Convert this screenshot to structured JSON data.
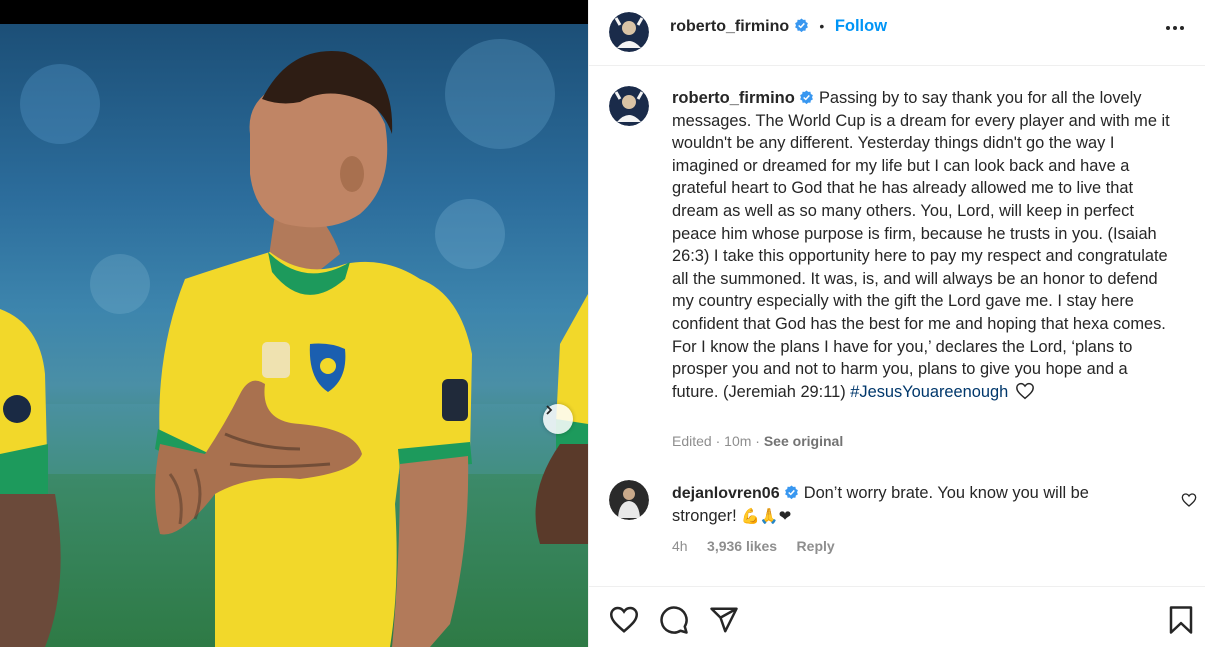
{
  "post": {
    "username": "roberto_firmino",
    "follow_label": "Follow",
    "separator": "•"
  },
  "caption": {
    "username": "roberto_firmino",
    "text": "Passing by to say thank you for all the lovely messages. The World Cup is a dream for every player and with me it wouldn't be any different. Yesterday things didn't go the way I imagined or dreamed for my life but I can look back and have a grateful heart to God that he has already allowed me to live that dream as well as so many others. You, Lord, will keep in perfect peace him whose purpose is firm, because he trusts in you. (Isaiah 26:3) I take this opportunity here to pay my respect and congratulate all the summoned. It was, is, and will always be an honor to defend my country especially with the gift the Lord gave me. I stay here confident that God has the best for me and hoping that hexa comes. For I know the plans I have for you,’ declares the Lord, ‘plans to prosper you and not to harm you, plans to give you hope and a future. (Jeremiah 29:11)",
    "hashtag": "#JesusYouareenough",
    "edited_label": "Edited",
    "time": "10m",
    "meta_sep": "·",
    "see_original": "See original"
  },
  "comment": {
    "username": "dejanlovren06",
    "text": "Don’t worry brate. You know you will be stronger!",
    "emojis": "💪🙏❤",
    "time": "4h",
    "likes": "3,936 likes",
    "reply_label": "Reply"
  },
  "icons": {
    "like": "heart-icon",
    "comment": "comment-icon",
    "share": "share-icon",
    "save": "bookmark-icon",
    "more": "more-options-icon",
    "next": "chevron-right-icon",
    "verified": "verified-badge-icon"
  },
  "colors": {
    "accent": "#0095f6",
    "verified": "#3897f0",
    "hashtag": "#00376b",
    "muted": "#8e8e8e",
    "jersey_yellow": "#f2d82a",
    "jersey_green": "#1d9a5c"
  }
}
